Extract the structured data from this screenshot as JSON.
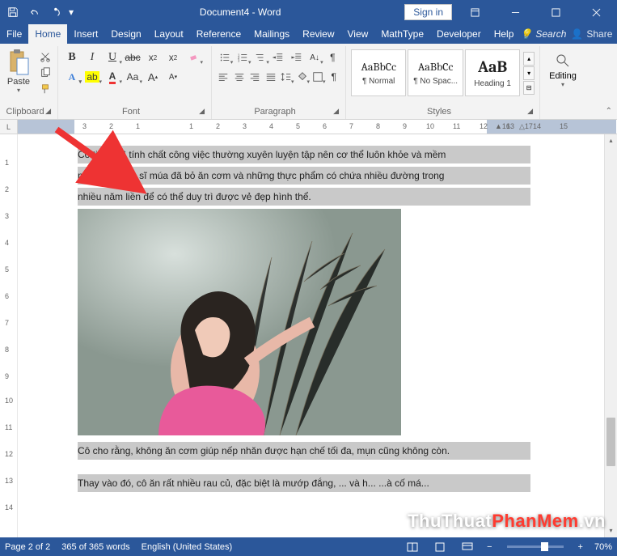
{
  "titlebar": {
    "title": "Document4 - Word",
    "signin": "Sign in"
  },
  "icons": {
    "save": "save-icon",
    "undo": "undo-icon",
    "redo": "redo-icon",
    "customize": "customize-qat",
    "ribbonopts": "ribbon-display-options",
    "minimize": "minimize-icon",
    "maximize": "restore-icon",
    "close": "close-icon"
  },
  "tabs": {
    "file": "File",
    "home": "Home",
    "insert": "Insert",
    "design": "Design",
    "layout": "Layout",
    "reference": "Reference",
    "mailings": "Mailings",
    "review": "Review",
    "view": "View",
    "mathtype": "MathType",
    "developer": "Developer",
    "help": "Help",
    "search": "Search",
    "share": "Share"
  },
  "ribbon": {
    "clipboard": {
      "paste": "Paste",
      "label": "Clipboard"
    },
    "font": {
      "label": "Font"
    },
    "paragraph": {
      "label": "Paragraph"
    },
    "styles": {
      "label": "Styles",
      "items": [
        {
          "preview": "AaBbCc",
          "name": "¶ Normal"
        },
        {
          "preview": "AaBbCc",
          "name": "¶ No Spac..."
        },
        {
          "preview": "AaB",
          "name": "Heading 1"
        }
      ]
    },
    "editing": {
      "label": "Editing"
    }
  },
  "document": {
    "p1": "Cô tiết lộ vì tính chất công việc thường xuyên luyện tập nên cơ thể luôn khỏe và mềm",
    "p2": "mại. Nữ nghệ sĩ múa đã bỏ ăn cơm và những thực phẩm có chứa nhiều đường trong",
    "p3": "nhiều năm liền để có thể duy trì được vẻ đẹp hình thể.",
    "p4": "Cô cho rằng, không ăn cơm giúp nếp nhăn được hạn chế tối đa, mụn cũng không còn.",
    "p5": "Thay vào đó, cô ăn rất nhiều rau củ, đặc biệt là mướp đắng, ... và h... ...à cố má..."
  },
  "statusbar": {
    "page": "Page 2 of 2",
    "words": "365 of 365 words",
    "lang": "English (United States)",
    "zoom": "70%"
  },
  "watermark": {
    "pre": "ThuThuat",
    "mid": "PhanMem",
    "suf": ".vn"
  }
}
